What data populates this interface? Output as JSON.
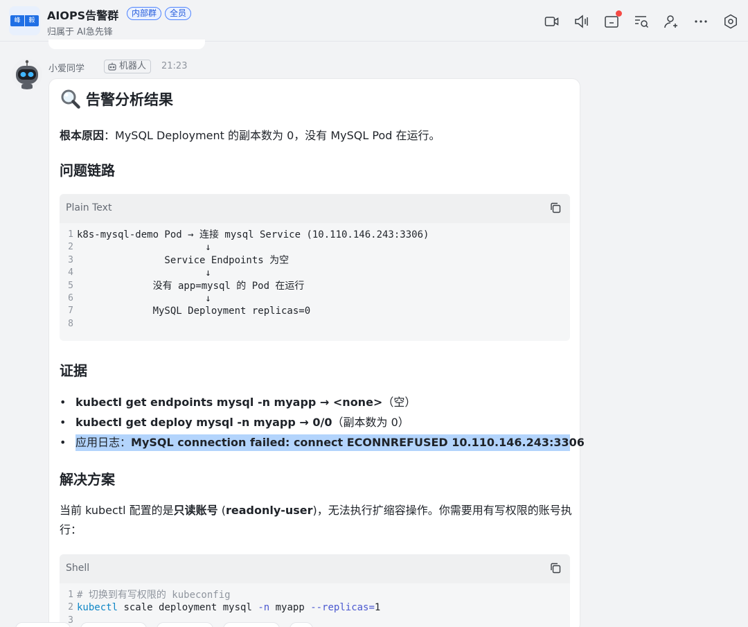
{
  "header": {
    "avatar_chars": [
      "峰",
      "毅"
    ],
    "title": "AIOPS告警群",
    "badges": [
      "内部群",
      "全员"
    ],
    "subtitle": "归属于 AI急先锋",
    "toolbar_icons": [
      "video-call-icon",
      "announcement-icon",
      "folder-icon",
      "search-chat-icon",
      "add-member-icon",
      "more-icon",
      "settings-icon"
    ]
  },
  "message": {
    "sender": "小爱同学",
    "bot_label": "机器人",
    "time": "21:23",
    "title": "告警分析结果",
    "root_cause_label": "根本原因",
    "root_cause_text": "：MySQL Deployment 的副本数为 0，没有 MySQL Pod 在运行。",
    "sections": {
      "chain": "问题链路",
      "evidence": "证据",
      "solution": "解决方案"
    },
    "chain_code": {
      "lang": "Plain Text",
      "lines": [
        {
          "n": "1",
          "text": "k8s-mysql-demo Pod → 连接 mysql Service (10.110.146.243:3306)"
        },
        {
          "n": "2",
          "text": "                      ↓"
        },
        {
          "n": "3",
          "text": "               Service Endpoints 为空"
        },
        {
          "n": "4",
          "text": "                      ↓"
        },
        {
          "n": "5",
          "text": "             没有 app=mysql 的 Pod 在运行"
        },
        {
          "n": "6",
          "text": "                      ↓"
        },
        {
          "n": "7",
          "text": "             MySQL Deployment replicas=0"
        },
        {
          "n": "8",
          "text": ""
        }
      ]
    },
    "evidence": [
      {
        "bold": "kubectl get endpoints mysql -n myapp → <none>",
        "rest": "（空）"
      },
      {
        "bold": "kubectl get deploy mysql -n myapp → 0/0",
        "rest": "（副本数为 0）"
      },
      {
        "prefix": "应用日志：",
        "bold": "MySQL connection failed: connect ECONNREFUSED 10.110.146.243:3306"
      }
    ],
    "solution_para": {
      "before": "当前 kubectl 配置的是",
      "bold1": "只读账号",
      "middle": " (",
      "bold2": "readonly-user",
      "after": ")，无法执行扩缩容操作。你需要用有写权限的账号执行："
    },
    "shell_code": {
      "lang": "Shell",
      "line1_num": "1",
      "line1": "# 切换到有写权限的 kubeconfig",
      "line2_num": "2",
      "line2_cmd": "kubectl",
      "line2_a": " scale deployment mysql ",
      "line2_flag1": "-n",
      "line2_b": " myapp ",
      "line2_flag2": "--replicas",
      "line2_eq": "=",
      "line2_val": "1",
      "line3_num": "3"
    }
  },
  "colors": {
    "accent": "#245bdb",
    "highlight": "#b3d4fc",
    "notify": "#f54a45"
  }
}
